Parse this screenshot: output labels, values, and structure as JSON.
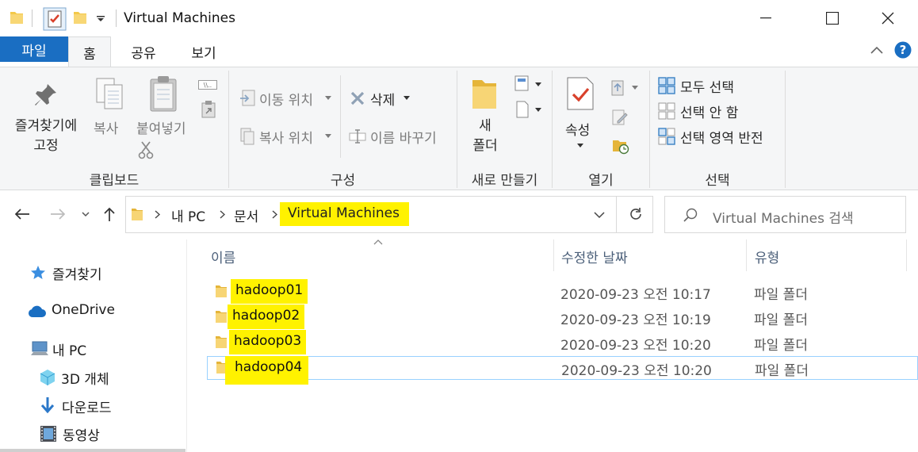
{
  "window": {
    "title": "Virtual Machines",
    "minimize_icon": "minimize-icon",
    "maximize_icon": "maximize-icon",
    "close_icon": "close-icon"
  },
  "ribbon_tabs": [
    "파일",
    "홈",
    "공유",
    "보기"
  ],
  "ribbon": {
    "clipboard": {
      "pin_label": "즐겨찾기에\n고정",
      "copy_label": "복사",
      "paste_label": "붙여넣기",
      "group_label": "클립보드"
    },
    "organize": {
      "move_to": "이동 위치",
      "copy_to": "복사 위치",
      "delete": "삭제",
      "rename": "이름 바꾸기",
      "group_label": "구성"
    },
    "new": {
      "new_folder": "새\n폴더",
      "group_label": "새로 만들기"
    },
    "open": {
      "properties": "속성",
      "group_label": "열기"
    },
    "select": {
      "select_all": "모두 선택",
      "select_none": "선택 안 함",
      "invert_selection": "선택 영역 반전",
      "group_label": "선택"
    }
  },
  "address": {
    "crumbs": [
      "내 PC",
      "문서",
      "Virtual Machines"
    ],
    "search_placeholder": "Virtual Machines 검색"
  },
  "nav_pane": {
    "items": [
      {
        "label": "즐겨찾기",
        "icon": "star-icon"
      },
      {
        "label": "OneDrive",
        "icon": "cloud-icon"
      },
      {
        "label": "내 PC",
        "icon": "computer-icon"
      },
      {
        "label": "3D 개체",
        "icon": "cube-icon"
      },
      {
        "label": "다운로드",
        "icon": "download-arrow-icon"
      },
      {
        "label": "동영상",
        "icon": "film-icon"
      }
    ]
  },
  "file_list": {
    "columns": [
      "이름",
      "수정한 날짜",
      "유형"
    ],
    "rows": [
      {
        "name": "hadoop01",
        "date": "2020-09-23 오전 10:17",
        "type": "파일 폴더"
      },
      {
        "name": "hadoop02",
        "date": "2020-09-23 오전 10:19",
        "type": "파일 폴더"
      },
      {
        "name": "hadoop03",
        "date": "2020-09-23 오전 10:20",
        "type": "파일 폴더"
      },
      {
        "name": "hadoop04",
        "date": "2020-09-23 오전 10:20",
        "type": "파일 폴더"
      }
    ]
  },
  "colors": {
    "file_tab": "#1a6ec2",
    "highlight": "#fff200",
    "folder": "#f3c94a",
    "selection_border": "#99d1ff"
  }
}
